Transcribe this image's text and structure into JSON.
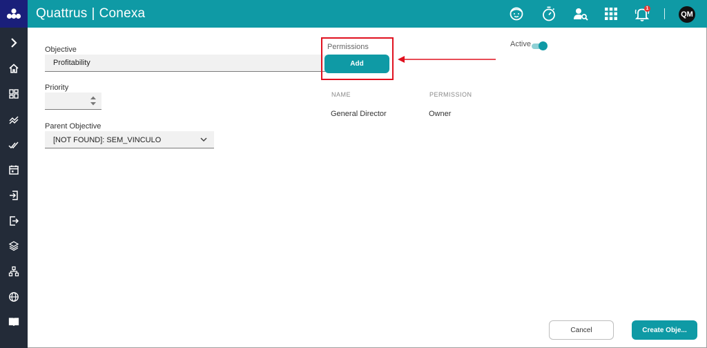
{
  "header": {
    "brand": "Quattrus",
    "separator": "|",
    "product": "Conexa",
    "notification_count": "1",
    "avatar_initials": "QM",
    "colors": {
      "header_bg": "#0f9aa5",
      "sidebar_bg": "#232b38",
      "logo_bg": "#1a1f7a"
    },
    "icons": [
      "support-agent-icon",
      "stopwatch-icon",
      "user-search-icon",
      "apps-grid-icon",
      "bell-icon"
    ]
  },
  "sidebar": {
    "items": [
      {
        "icon": "chevron-right-icon"
      },
      {
        "icon": "home-icon"
      },
      {
        "icon": "dashboard-icon"
      },
      {
        "icon": "trending-icon"
      },
      {
        "icon": "done-all-icon"
      },
      {
        "icon": "calendar-icon"
      },
      {
        "icon": "login-icon"
      },
      {
        "icon": "logout-icon"
      },
      {
        "icon": "layers-icon"
      },
      {
        "icon": "hierarchy-icon"
      },
      {
        "icon": "globe-icon"
      },
      {
        "icon": "book-icon"
      }
    ]
  },
  "form": {
    "objective_label": "Objective",
    "objective_value": "Profitability",
    "priority_label": "Priority",
    "priority_value": "",
    "parent_label": "Parent Objective",
    "parent_value": "[NOT FOUND]: SEM_VINCULO"
  },
  "permissions": {
    "title": "Permissions",
    "add_label": "Add",
    "columns": [
      "NAME",
      "PERMISSION"
    ],
    "rows": [
      {
        "name": "General Director",
        "permission": "Owner"
      }
    ]
  },
  "active": {
    "label": "Active",
    "on": true
  },
  "footer": {
    "cancel_label": "Cancel",
    "create_label": "Create Obje..."
  }
}
